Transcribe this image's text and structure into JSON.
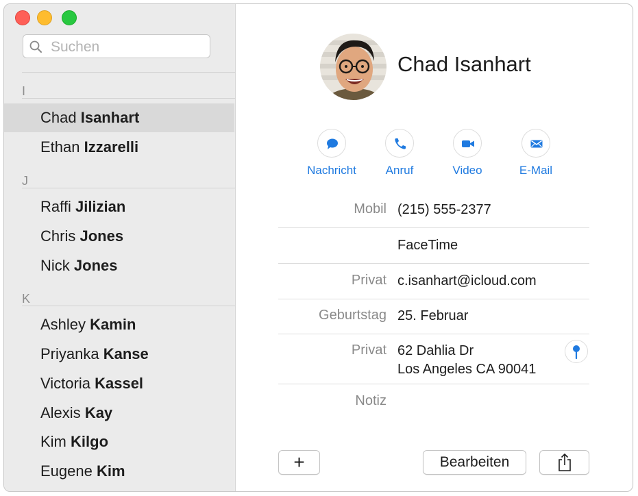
{
  "search": {
    "placeholder": "Suchen",
    "value": ""
  },
  "contact_list": {
    "sections": [
      {
        "letter": "I",
        "contacts": [
          {
            "first": "Chad",
            "last": "Isanhart",
            "selected": true
          },
          {
            "first": "Ethan",
            "last": "Izzarelli",
            "selected": false
          }
        ]
      },
      {
        "letter": "J",
        "contacts": [
          {
            "first": "Raffi",
            "last": "Jilizian"
          },
          {
            "first": "Chris",
            "last": "Jones"
          },
          {
            "first": "Nick",
            "last": "Jones"
          }
        ]
      },
      {
        "letter": "K",
        "contacts": [
          {
            "first": "Ashley",
            "last": "Kamin"
          },
          {
            "first": "Priyanka",
            "last": "Kanse"
          },
          {
            "first": "Victoria",
            "last": "Kassel"
          },
          {
            "first": "Alexis",
            "last": "Kay"
          },
          {
            "first": "Kim",
            "last": "Kilgo"
          },
          {
            "first": "Eugene",
            "last": "Kim"
          }
        ]
      }
    ]
  },
  "detail": {
    "name": "Chad Isanhart",
    "actions": [
      {
        "label": "Nachricht",
        "icon": "message-icon"
      },
      {
        "label": "Anruf",
        "icon": "phone-icon"
      },
      {
        "label": "Video",
        "icon": "video-icon"
      },
      {
        "label": "E-Mail",
        "icon": "mail-icon"
      }
    ],
    "fields": {
      "mobile": {
        "label": "Mobil",
        "value": "(215) 555-2377"
      },
      "facetime": {
        "label": "",
        "value": "FaceTime"
      },
      "email": {
        "label": "Privat",
        "value": "c.isanhart@icloud.com"
      },
      "birthday": {
        "label": "Geburtstag",
        "value": "25. Februar"
      },
      "address": {
        "label": "Privat",
        "line1": "62 Dahlia Dr",
        "line2": "Los Angeles CA 90041"
      },
      "note": {
        "label": "Notiz",
        "value": ""
      }
    }
  },
  "footer": {
    "add_label": "+",
    "edit_label": "Bearbeiten",
    "share_icon": "share-icon"
  },
  "colors": {
    "accent": "#1f7ae0",
    "sidebar_bg": "#ebebeb",
    "selection": "#d9d9d9"
  }
}
